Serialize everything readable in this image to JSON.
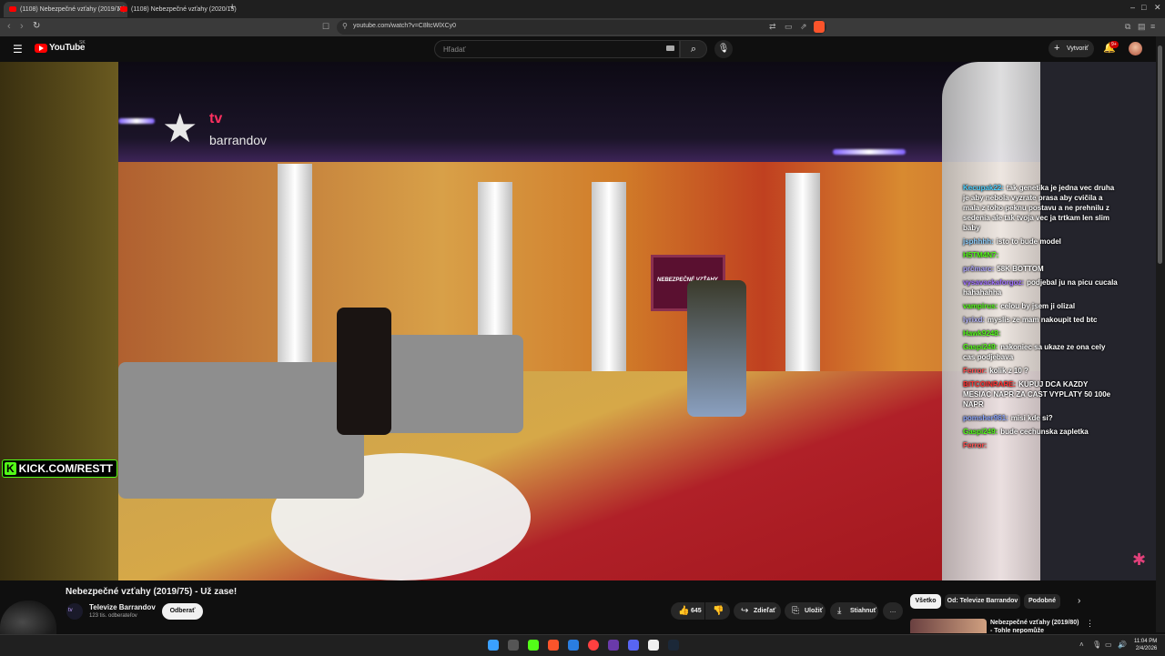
{
  "browser": {
    "tabs": [
      {
        "label": "(1108) Nebezpečné vzťahy (2019/75)",
        "active": true
      },
      {
        "label": "(1108) Nebezpečné vzťahy (2020/15)",
        "active": false
      }
    ],
    "new_tab": "+",
    "url": "youtube.com/watch?v=C8ltcWlXCy0",
    "window_controls": {
      "minimize": "–",
      "maximize": "□",
      "close": "✕"
    }
  },
  "youtube_header": {
    "logo_text": "YouTube",
    "region": "SK",
    "search_placeholder": "Hľadať",
    "create_label": "Vytvoriť",
    "notification_badge": "9+"
  },
  "video_overlay": {
    "channel_logo_tv": "tv",
    "channel_logo_name": "barrandov",
    "studio_screen_text": "NEBEZPEČNÉ VZŤAHY",
    "kick_prefix": "K",
    "kick_text": "KICK.COM/RESTT"
  },
  "chat": [
    {
      "user": "Kecupak22:",
      "text": "tak genetika je jedna vec druha je aby nebola vyzrate prasa aby cvičila a mala z toho peknu postavu a ne prehnilu z sedenia ale tak tvoja vec ja trtkam len slim baby",
      "color": "#4fd1ff"
    },
    {
      "user": "jsphhhh:",
      "text": "isto to bude model",
      "color": "#8fd0ff"
    },
    {
      "user": "H5TM4N7:",
      "text": "",
      "color": "#53fc18"
    },
    {
      "user": "prčmarc:",
      "text": "58K BOTTOM",
      "color": "#b0a8ff"
    },
    {
      "user": "vysavackaforgoz:",
      "text": "podjebal ju na picu cucala hahahahha",
      "color": "#a070ff"
    },
    {
      "user": "vampirus:",
      "text": "celou by jsem ji olizal",
      "color": "#53fc18"
    },
    {
      "user": "lyrixd:",
      "text": "myslis ze mam nakoupit ted btc",
      "color": "#b8b8ff"
    },
    {
      "user": "Hawk9248:",
      "text": "",
      "color": "#53fc18"
    },
    {
      "user": "Gaspi249:",
      "text": "nakoniec sa ukaze ze ona cely cas podjebava",
      "color": "#53fc18"
    },
    {
      "user": "Ferror:",
      "text": "kolik z 10 ?",
      "color": "#ff5050"
    },
    {
      "user": "BITCOINRARE:",
      "text": "KUPUJ DCA KAZDY MESIAC NAPR ZA CAST VYPLATY 50 100e NAPR",
      "color": "#ff3030"
    },
    {
      "user": "pomsher961:",
      "text": "misi kde si?",
      "color": "#8fa8ff"
    },
    {
      "user": "Gaspi249:",
      "text": "bude cechunska zapletka",
      "color": "#53fc18"
    },
    {
      "user": "Ferror:",
      "text": "",
      "color": "#ff5050"
    }
  ],
  "video_info": {
    "title": "Nebezpečné vzťahy (2019/75) - Už zase!",
    "channel_name": "Televize Barrandov",
    "subscribers": "123 tis. odberateľov",
    "subscribe_label": "Odberať",
    "likes": "645",
    "share_label": "Zdieľať",
    "save_label": "Uložiť",
    "download_label": "Stiahnuť",
    "more_label": "…"
  },
  "recommendations": {
    "chips": [
      "Všetko",
      "Od: Televize Barrandov",
      "Podobné"
    ],
    "first_title": "Nebezpečné vzťahy (2019/80) - Tohle nepomůže"
  },
  "taskbar": {
    "time": "11:04 PM",
    "date": "2/4/2026"
  }
}
